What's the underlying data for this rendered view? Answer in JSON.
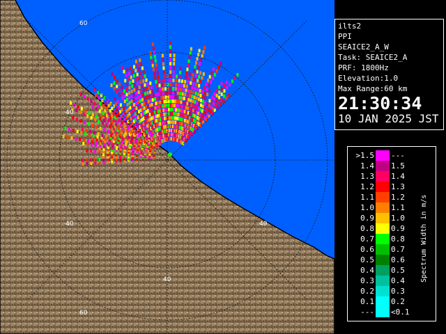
{
  "station": "ilts2",
  "product": "PPI",
  "scan_name": "SEAICE2_A_W",
  "task": "Task: SEAICE2_A",
  "prf": "PRF: 1800Hz",
  "elevation": "Elevation:1.0",
  "max_range": "Max Range:60 km",
  "time": "21:30:34",
  "date": "10 JAN 2025 JST",
  "legend_title": "Spectrum Width in m/s",
  "legend_rows": [
    {
      "low": ">1.5",
      "high": "---",
      "color": "#ff00ff"
    },
    {
      "low": "1.4",
      "high": "1.5",
      "color": "#c00080"
    },
    {
      "low": "1.3",
      "high": "1.4",
      "color": "#ff0060"
    },
    {
      "low": "1.2",
      "high": "1.3",
      "color": "#ff0000"
    },
    {
      "low": "1.1",
      "high": "1.2",
      "color": "#ff4000"
    },
    {
      "low": "1.0",
      "high": "1.1",
      "color": "#ff8000"
    },
    {
      "low": "0.9",
      "high": "1.0",
      "color": "#ffc000"
    },
    {
      "low": "0.8",
      "high": "0.9",
      "color": "#ffff00"
    },
    {
      "low": "0.7",
      "high": "0.8",
      "color": "#00ff00"
    },
    {
      "low": "0.6",
      "high": "0.7",
      "color": "#00c000"
    },
    {
      "low": "0.5",
      "high": "0.6",
      "color": "#008000"
    },
    {
      "low": "0.4",
      "high": "0.5",
      "color": "#00a060"
    },
    {
      "low": "0.3",
      "high": "0.4",
      "color": "#00c0a0"
    },
    {
      "low": "0.2",
      "high": "0.3",
      "color": "#00e0d0"
    },
    {
      "low": "0.1",
      "high": "0.2",
      "color": "#00ffff"
    },
    {
      "low": "---",
      "high": "<0.1",
      "color": "#00ffff"
    }
  ],
  "range_labels": [
    "60",
    "40",
    "40",
    "40",
    "40",
    "60"
  ],
  "colors": {
    "sea": "#0060ff",
    "land": "#8b7355",
    "coast": "#000000",
    "rivers": "#6a6aff",
    "roads": "#c04040"
  }
}
